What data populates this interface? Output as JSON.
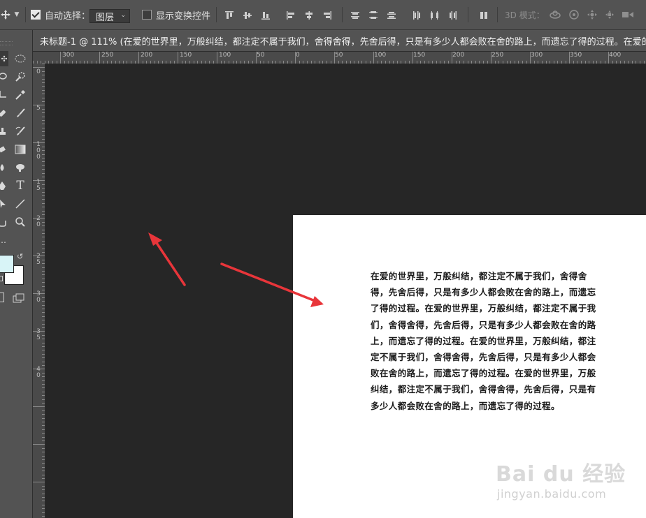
{
  "options_bar": {
    "auto_select_label": "自动选择：",
    "auto_select_checked": true,
    "auto_select_target": "图层",
    "show_transform_label": "显示变换控件",
    "show_transform_checked": false,
    "mode_3d_label": "3D 模式："
  },
  "document_tab": {
    "title": "未标题-1 @ 111% (在爱的世界里，万般纠结，都注定不属于我们，舍得舍得，先舍后得，只是有多少人都会败在舍的路上，而遗忘了得的过程。在爱的世"
  },
  "ruler": {
    "h_labels": [
      "300",
      "250",
      "200",
      "150",
      "100",
      "50",
      "0",
      "50",
      "100",
      "150",
      "200",
      "250",
      "300",
      "350",
      "400"
    ],
    "v_labels": [
      "0",
      "5",
      "1\n0\n0",
      "1\n5",
      "2\n0",
      "2\n5",
      "3\n0",
      "3\n5",
      "4\n0"
    ]
  },
  "toolbar": {
    "text_tool_glyph": "T"
  },
  "colors": {
    "foreground": "#d8f4f7",
    "background": "#ffffff",
    "arrow": "#e8353a"
  },
  "document_text": "在爱的世界里，万般纠结，都注定不属于我们，舍得舍得，先舍后得，只是有多少人都会败在舍的路上，而遗忘了得的过程。在爱的世界里，万般纠结，都注定不属于我们，舍得舍得，先舍后得，只是有多少人都会败在舍的路上，而遗忘了得的过程。在爱的世界里，万般纠结，都注定不属于我们，舍得舍得，先舍后得，只是有多少人都会败在舍的路上，而遗忘了得的过程。在爱的世界里，万般纠结，都注定不属于我们，舍得舍得，先舍后得，只是有多少人都会败在舍的路上，而遗忘了得的过程。",
  "watermark": {
    "logo_text": "Bai du 经验",
    "url": "jingyan.baidu.com"
  }
}
